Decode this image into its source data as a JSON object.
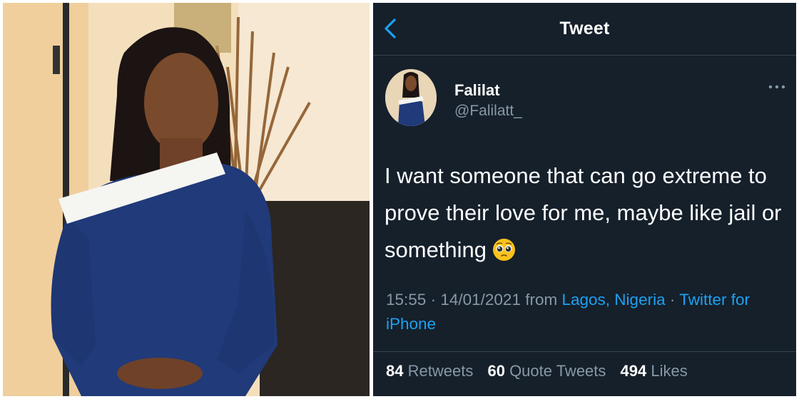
{
  "header": {
    "title": "Tweet",
    "back_icon": "chevron-left-icon"
  },
  "author": {
    "name": "Falilat",
    "handle": "@Falilatt_",
    "more_icon": "more-dots-icon"
  },
  "tweet": {
    "text": "I want someone that can go extreme to prove their love for me, maybe like jail or something",
    "emoji": "pleading-face-emoji",
    "time": "15:55",
    "sep1": "·",
    "date": "14/01/2021",
    "from_label": "from",
    "location": "Lagos, Nigeria",
    "sep2": "·",
    "source": "Twitter for iPhone"
  },
  "stats": {
    "retweets_count": "84",
    "retweets_label": "Retweets",
    "quotes_count": "60",
    "quotes_label": "Quote Tweets",
    "likes_count": "494",
    "likes_label": "Likes"
  },
  "colors": {
    "background": "#15202b",
    "accent": "#1da1f2",
    "muted": "#8899a6",
    "divider": "#38444d"
  }
}
